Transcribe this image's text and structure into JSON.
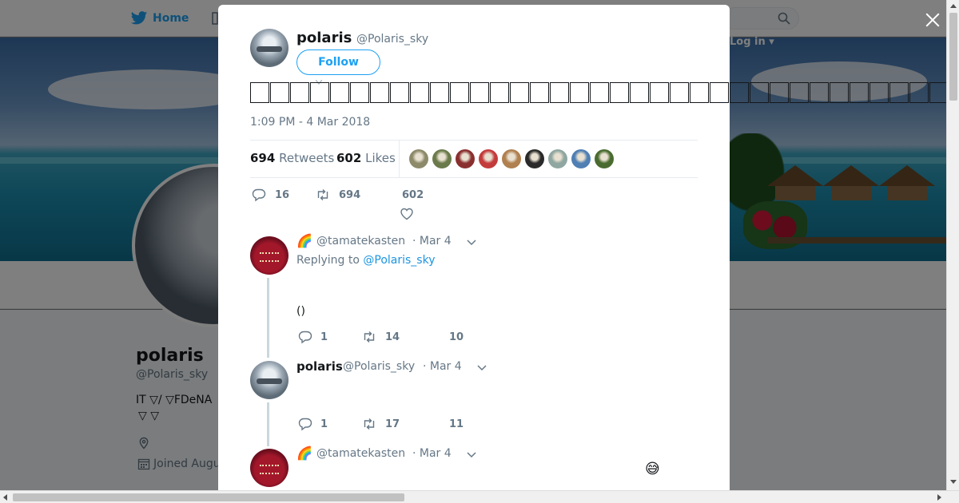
{
  "background": {
    "nav": {
      "home_label": "Home",
      "login_label": "Log in"
    },
    "profile": {
      "name": "polaris",
      "handle": "@Polaris_sky",
      "bio_line1": "IT ▽/ ▽FDeNA",
      "bio_line2": "▽ ▽",
      "joined": "Joined Augu"
    }
  },
  "tweet": {
    "author_name": "polaris",
    "author_handle": "@Polaris_sky",
    "follow_label": "Follow",
    "text_glyph_count": 35,
    "timestamp": "1:09 PM - 4 Mar 2018",
    "retweets_count": "694",
    "retweets_label": "Retweets",
    "likes_count": "602",
    "likes_label": "Likes",
    "likers_colors": [
      "#8d8a6a",
      "#6b7a4a",
      "#8a2f2f",
      "#c43b3b",
      "#b0804f",
      "#2a2a2a",
      "#8fa7a0",
      "#4f7fb3",
      "#4a6b2f"
    ],
    "actions": {
      "replies": "16",
      "retweets": "694",
      "likes": "602"
    }
  },
  "replies": [
    {
      "name_emoji": "🌈",
      "handle": "@tamatekasten",
      "time": "· Mar 4",
      "replying_prefix": "Replying to",
      "replying_to": "@Polaris_sky",
      "text": "()",
      "actions": {
        "replies": "1",
        "retweets": "14",
        "likes": "10"
      }
    },
    {
      "name": "polaris",
      "handle": "@Polaris_sky",
      "time": "· Mar 4",
      "actions": {
        "replies": "1",
        "retweets": "17",
        "likes": "11"
      }
    },
    {
      "name_emoji": "🌈",
      "handle": "@tamatekasten",
      "time": "· Mar 4",
      "emoji": "😅"
    }
  ],
  "colors": {
    "accent": "#1da1f2",
    "text_secondary": "#657786",
    "border": "#e6ecf0"
  }
}
